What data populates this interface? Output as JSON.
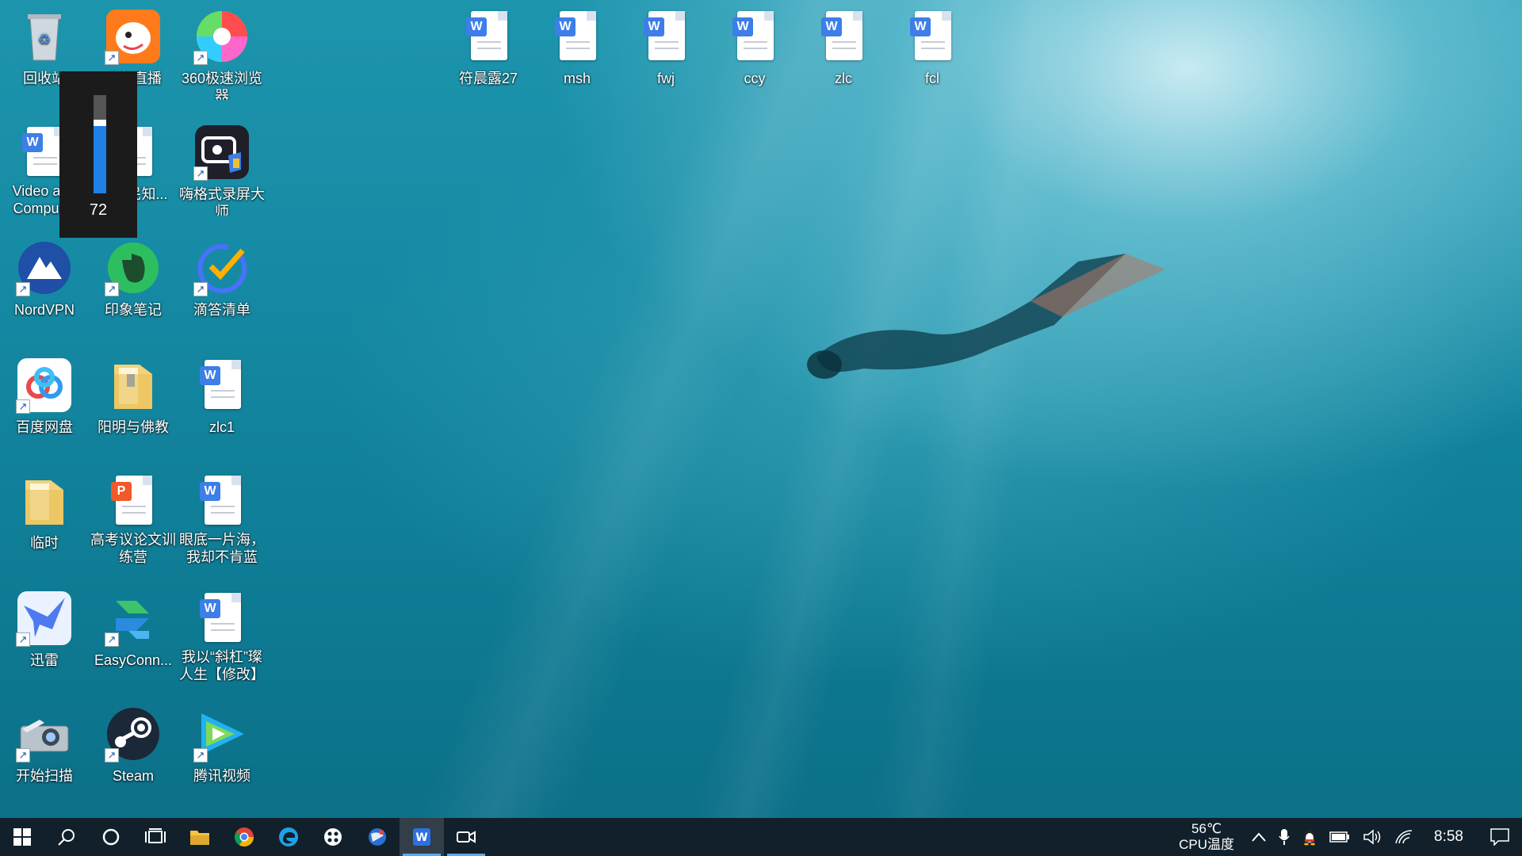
{
  "desktop": {
    "icons": [
      {
        "id": "recycle-bin",
        "label": "回收站"
      },
      {
        "id": "douyu",
        "label": "斗鱼直播"
      },
      {
        "id": "browser360",
        "label": "360极速浏览器"
      },
      {
        "id": "video-doc",
        "label": "Video and Computer"
      },
      {
        "id": "lishi-doc",
        "label": "李世民知..."
      },
      {
        "id": "recorder",
        "label": "嗨格式录屏大师"
      },
      {
        "id": "nordvpn",
        "label": "NordVPN"
      },
      {
        "id": "evernote",
        "label": "印象笔记"
      },
      {
        "id": "dida",
        "label": "滴答清单"
      },
      {
        "id": "baidupan",
        "label": "百度网盘"
      },
      {
        "id": "yangming",
        "label": "阳明与佛教"
      },
      {
        "id": "zlc1",
        "label": "zlc1"
      },
      {
        "id": "linshi",
        "label": "临时"
      },
      {
        "id": "gaokao",
        "label": "高考议论文训练营"
      },
      {
        "id": "yandi",
        "label": "眼底一片海，我却不肯蓝"
      },
      {
        "id": "xunlei",
        "label": "迅雷"
      },
      {
        "id": "easyconn",
        "label": "EasyConn..."
      },
      {
        "id": "xiegang",
        "label": "我以“斜杠”璨人生【修改】"
      },
      {
        "id": "scan",
        "label": "开始扫描"
      },
      {
        "id": "steam",
        "label": "Steam"
      },
      {
        "id": "tencentvideo",
        "label": "腾讯视频"
      },
      {
        "id": "fuchenlu",
        "label": "符晨露27"
      },
      {
        "id": "msh",
        "label": "msh"
      },
      {
        "id": "fwj",
        "label": "fwj"
      },
      {
        "id": "ccy",
        "label": "ccy"
      },
      {
        "id": "zlc",
        "label": "zlc"
      },
      {
        "id": "fcl",
        "label": "fcl"
      }
    ]
  },
  "volume": {
    "value": "72",
    "level": 0.72
  },
  "taskbar": {
    "buttons": [
      "start-icon",
      "search-icon",
      "cortana-icon",
      "task-view-icon",
      "file-explorer-icon",
      "chrome-icon",
      "edge-icon",
      "app-dots-icon",
      "app-globe-icon",
      "wps-writer-icon",
      "video-camera-icon"
    ],
    "cpu_temp": "56℃",
    "cpu_label": "CPU温度",
    "time": "8:58"
  }
}
